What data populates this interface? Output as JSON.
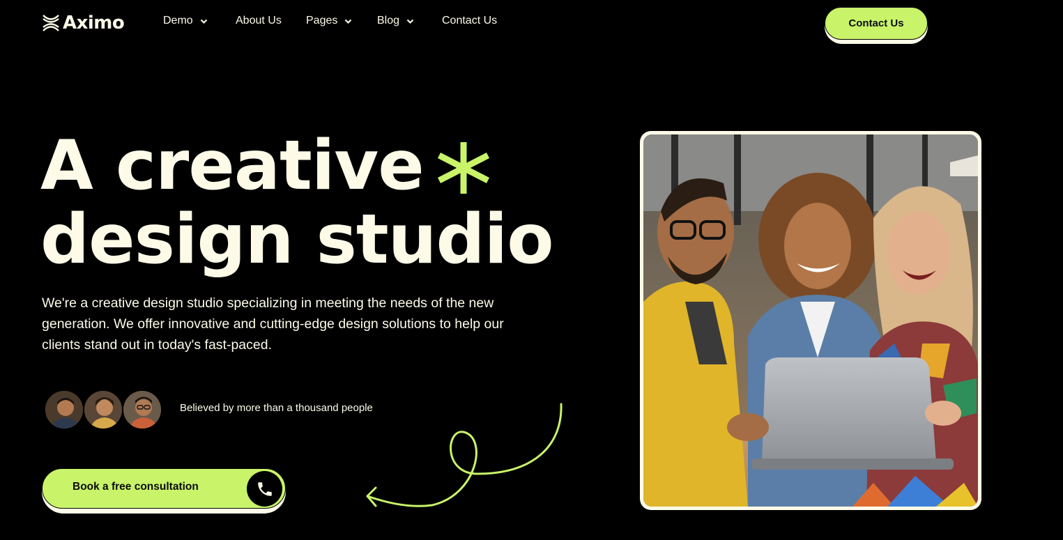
{
  "header": {
    "brand": "Aximo",
    "nav": [
      {
        "label": "Demo",
        "has_dropdown": true
      },
      {
        "label": "About Us",
        "has_dropdown": false
      },
      {
        "label": "Pages",
        "has_dropdown": true
      },
      {
        "label": "Blog",
        "has_dropdown": true
      },
      {
        "label": "Contact Us",
        "has_dropdown": false
      }
    ],
    "cta_label": "Contact Us"
  },
  "hero": {
    "title_line1": "A creative",
    "title_line2": "design studio",
    "description": "We're a creative design studio specializing in meeting the needs of the new generation. We offer innovative and cutting-edge design solutions to help our clients stand out in today's fast-paced.",
    "social_proof": "Believed by more than a thousand people",
    "book_label": "Book a free consultation",
    "avatars": [
      "avatar-icon",
      "avatar-icon",
      "avatar-icon"
    ],
    "icons": {
      "asterisk": "asterisk-icon",
      "phone": "phone-icon",
      "arrow": "curly-arrow-icon"
    }
  },
  "colors": {
    "background": "#000000",
    "accent": "#c9f46a",
    "text": "#fdfbe8"
  }
}
